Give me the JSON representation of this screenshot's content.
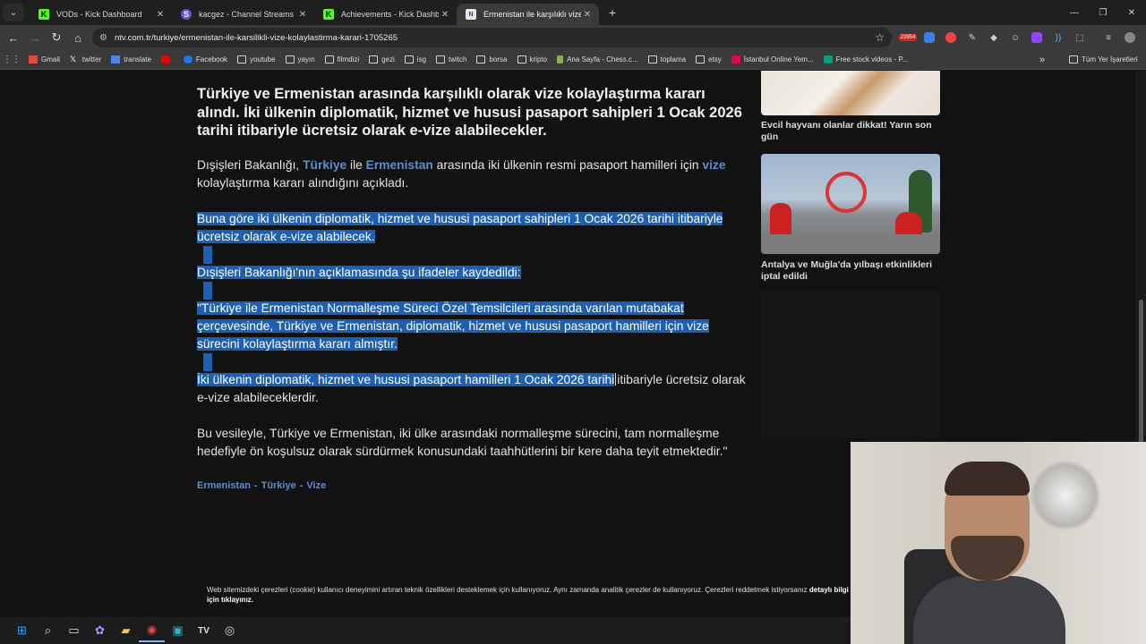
{
  "tabs": [
    {
      "label": "VODs - Kick Dashboard",
      "icon": "kick-icon",
      "active": false
    },
    {
      "label": "kacgez - Channel Streams on Ki",
      "icon": "streams-icon",
      "active": false
    },
    {
      "label": "Achievements - Kick Dashboard",
      "icon": "kick-icon",
      "active": false
    },
    {
      "label": "Ermenistan ile karşılıklı vize kol",
      "icon": "ntv-icon",
      "active": true
    }
  ],
  "new_tab_label": "+",
  "address": {
    "url": "ntv.com.tr/turkiye/ermenistan-ile-karsilikli-vize-kolaylastirma-karari-1705265"
  },
  "extension_badge": "23954",
  "bookmarks": [
    {
      "label": "Gmail",
      "icon": "gmail-icon"
    },
    {
      "label": "twitter",
      "icon": "x-icon"
    },
    {
      "label": "translate",
      "icon": "translate-icon"
    },
    {
      "label": "",
      "icon": "youtube-icon"
    },
    {
      "label": "Facebook",
      "icon": "facebook-icon"
    },
    {
      "label": "youtube",
      "icon": "folder-icon"
    },
    {
      "label": "yayın",
      "icon": "folder-icon"
    },
    {
      "label": "filmdizi",
      "icon": "folder-icon"
    },
    {
      "label": "gezi",
      "icon": "folder-icon"
    },
    {
      "label": "isg",
      "icon": "folder-icon"
    },
    {
      "label": "twitch",
      "icon": "folder-icon"
    },
    {
      "label": "borsa",
      "icon": "folder-icon"
    },
    {
      "label": "kripto",
      "icon": "folder-icon"
    },
    {
      "label": "Ana Sayfa - Chess.c...",
      "icon": "chess-icon"
    },
    {
      "label": "toplama",
      "icon": "folder-icon"
    },
    {
      "label": "etsy",
      "icon": "folder-icon"
    },
    {
      "label": "İstanbul Online Yem...",
      "icon": "yemeksepeti-icon"
    },
    {
      "label": "Free stock videos - P...",
      "icon": "pexels-icon"
    }
  ],
  "bookmarks_more": "»",
  "bookmarks_all": "Tüm Yer İşaretleri",
  "article": {
    "headline": "Türkiye ve Ermenistan arasında karşılıklı olarak vize kolaylaştırma kararı alındı. İki ülkenin diplomatik, hizmet ve hususi pasaport sahipleri 1 Ocak 2026 tarihi itibariyle ücretsiz olarak e-vize alabilecekler.",
    "p1_a": "Dışişleri Bakanlığı, ",
    "p1_link1": "Türkiye",
    "p1_b": " ile ",
    "p1_link2": "Ermenistan",
    "p1_c": " arasında iki ülkenin resmi pasaport hamilleri için ",
    "p1_link3": "vize",
    "p1_d": " kolaylaştırma kararı alındığını açıkladı.",
    "p2": "Buna göre iki ülkenin diplomatik, hizmet ve hususi pasaport sahipleri 1 Ocak 2026 tarihi itibariyle ücretsiz olarak e-vize alabilecek.",
    "p3": "Dışişleri Bakanlığı'nın açıklamasında şu ifadeler kaydedildi:",
    "p4": "\"Türkiye ile Ermenistan Normalleşme Süreci Özel Temsilcileri arasında varılan mutabakat çerçevesinde, Türkiye ve Ermenistan, diplomatik, hizmet ve hususi pasaport hamilleri için vize sürecini kolaylaştırma kararı almıştır.",
    "p5_selected": "İki ülkenin diplomatik, hizmet ve hususi pasaport hamilleri 1 Ocak 2026 tarihi",
    "p5_rest": "itibariyle ücretsiz olarak e-vize alabileceklerdir.",
    "p6": "Bu vesileyle, Türkiye ve Ermenistan, iki ülke arasındaki normalleşme sürecini, tam normalleşme hedefiyle ön koşulsuz olarak sürdürmek konusundaki taahhütlerini bir kere daha teyit etmektedir.\"",
    "tags": [
      "Ermenistan",
      "Türkiye",
      "Vize"
    ],
    "tag_sep": "-"
  },
  "sidebar": {
    "card1_title": "Evcil hayvanı olanlar dikkat! Yarın son gün",
    "card2_title": "Antalya ve Muğla'da yılbaşı etkinlikleri iptal edildi"
  },
  "cookie": {
    "text": "Web sitemizdeki çerezleri (cookie) kullanıcı deneyimini artıran teknik özellikleri desteklemek için kullanıyoruz. Aynı zamanda analitik çerezler de kullanıyoruz. Çerezleri reddetmek istiyorsanız",
    "link": "detaylı bilgi için tıklayınız."
  },
  "colors": {
    "link": "#5b8fcf",
    "selection": "#1d5fb0",
    "page_bg": "#121212"
  }
}
